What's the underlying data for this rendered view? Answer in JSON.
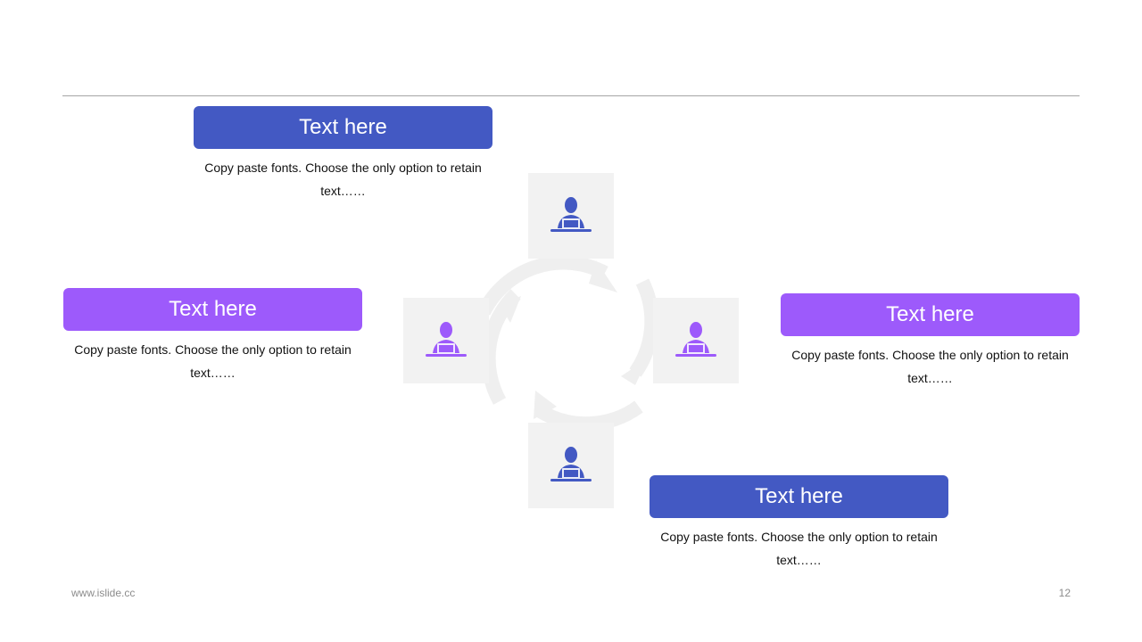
{
  "blocks": [
    {
      "title": "Text here",
      "desc": "Copy paste fonts. Choose the only option to retain text……",
      "color": "#4359c3"
    },
    {
      "title": "Text here",
      "desc": "Copy paste fonts. Choose the only option to retain text……",
      "color": "#9d5afb"
    },
    {
      "title": "Text here",
      "desc": "Copy paste fonts. Choose the only option to retain text……",
      "color": "#9d5afb"
    },
    {
      "title": "Text here",
      "desc": "Copy paste fonts. Choose the only option to retain text……",
      "color": "#4359c3"
    }
  ],
  "icons": {
    "top": "person-at-laptop-icon",
    "left": "person-at-laptop-icon",
    "right": "person-at-laptop-icon",
    "bottom": "person-at-laptop-icon",
    "center": "cycle-arrows-icon"
  },
  "footer": {
    "url": "www.islide.cc",
    "page": "12"
  }
}
